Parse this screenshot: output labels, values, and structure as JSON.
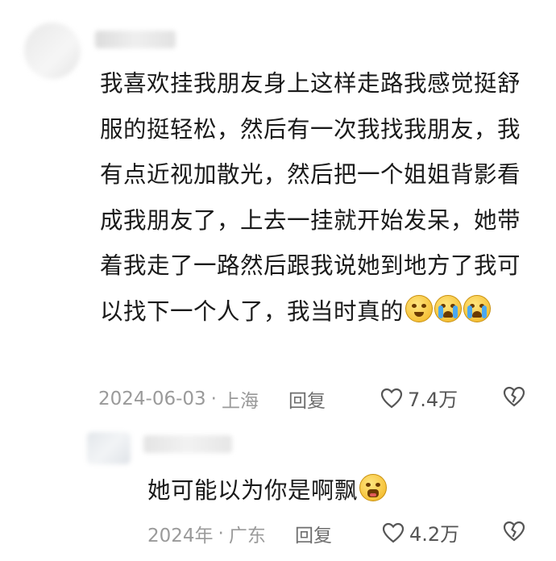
{
  "comment": {
    "lines": [
      "我喜欢挂我朋友身上这样走路我感觉挺舒",
      "服的挺轻松，然后有一次我找我朋友，我",
      "有点近视加散光，然后把一个姐姐背影看",
      "成我朋友了，上去一挂就开始发呆，她带",
      "着我走了一路然后跟我说她到地方了我可",
      "以找下一个人了，我当时真的"
    ],
    "emojis": [
      "dizzy-face-icon",
      "crying-face-icon",
      "crying-face-icon"
    ],
    "date": "2024-06-03",
    "separator": "·",
    "location": "上海",
    "reply_label": "回复",
    "likes": "7.4万"
  },
  "reply": {
    "text": "她可能以为你是啊飘",
    "emoji": "sobbing-face-icon",
    "date": "2024年",
    "separator": "·",
    "location": "广东",
    "reply_label": "回复",
    "likes": "4.2万"
  },
  "colors": {
    "text": "#1a1a1a",
    "meta": "#9a9a9a",
    "icon": "#555555",
    "emoji": "#f6c23a"
  }
}
